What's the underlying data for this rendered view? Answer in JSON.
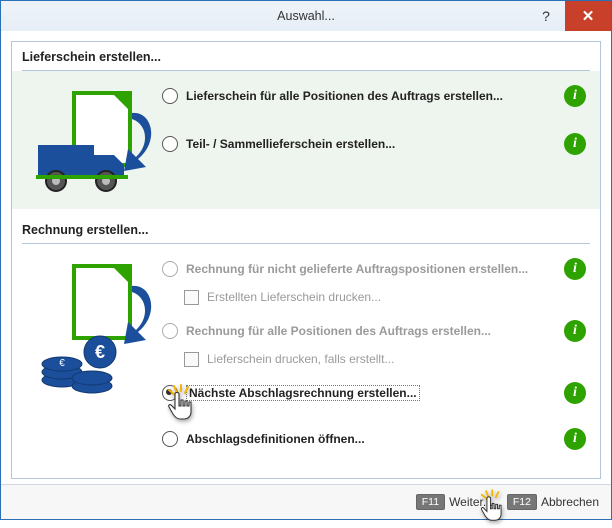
{
  "window": {
    "title": "Auswahl..."
  },
  "section1": {
    "heading": "Lieferschein erstellen...",
    "opt_all": "Lieferschein für alle Positionen des Auftrags erstellen...",
    "opt_partial": "Teil- / Sammellieferschein erstellen..."
  },
  "section2": {
    "heading": "Rechnung erstellen...",
    "opt_notdelivered": "Rechnung für nicht gelieferte Auftragspositionen erstellen...",
    "chk_printls": "Erstellten Lieferschein drucken...",
    "opt_all": "Rechnung für alle Positionen des Auftrags erstellen...",
    "chk_printls2": "Lieferschein drucken, falls erstellt...",
    "opt_abschlag": "Nächste Abschlagsrechnung erstellen...",
    "opt_abschlagdef": "Abschlagsdefinitionen öffnen..."
  },
  "footer": {
    "f11": "F11",
    "next": "Weiter...",
    "f12": "F12",
    "cancel": "Abbrechen"
  },
  "icons": {
    "info": "i",
    "help": "?",
    "close": "✕"
  }
}
